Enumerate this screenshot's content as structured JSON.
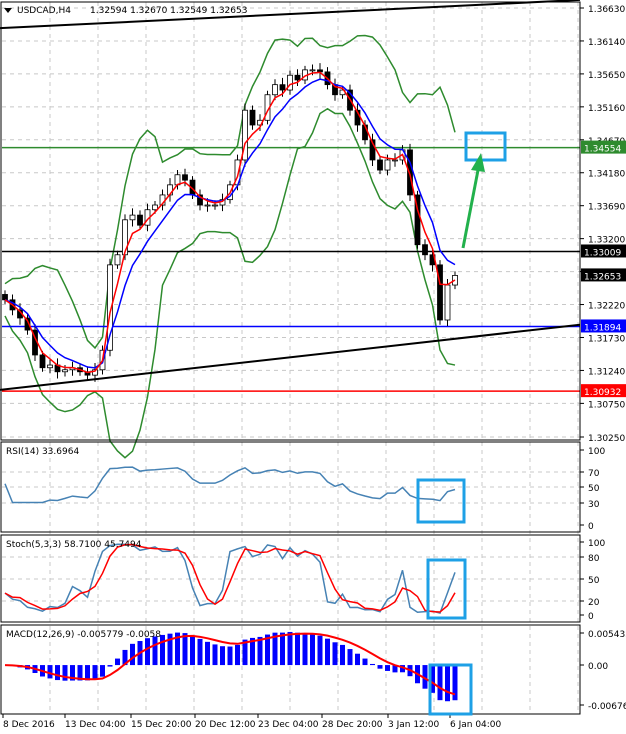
{
  "chart_data": {
    "type": "candlestick",
    "symbol_header": "USDCAD,H4",
    "ohlc_header": "1.32594 1.32670 1.32549 1.32653",
    "timeframe": "H4",
    "closes": [
      1.3229,
      1.3214,
      1.3202,
      1.3184,
      1.3147,
      1.3128,
      1.3132,
      1.3122,
      1.3125,
      1.3128,
      1.3122,
      1.3117,
      1.3125,
      1.3154,
      1.3281,
      1.3296,
      1.3348,
      1.3355,
      1.334,
      1.3363,
      1.337,
      1.3385,
      1.34,
      1.3415,
      1.3407,
      1.3385,
      1.337,
      1.337,
      1.337,
      1.3378,
      1.34,
      1.3437,
      1.3511,
      1.3489,
      1.3496,
      1.3534,
      1.3549,
      1.3541,
      1.3563,
      1.3556,
      1.3571,
      1.3571,
      1.3568,
      1.3549,
      1.3534,
      1.3541,
      1.3511,
      1.3489,
      1.3467,
      1.3437,
      1.3422,
      1.3437,
      1.3437,
      1.3452,
      1.3385,
      1.3311,
      1.3296,
      1.3281,
      1.3199,
      1.3251,
      1.32653
    ],
    "ylim": [
      1.3025,
      1.3663
    ],
    "price_ticks": [
      "1.36630",
      "1.36140",
      "1.35650",
      "1.35160",
      "1.34670",
      "1.34180",
      "1.33690",
      "1.33200",
      "1.32710",
      "1.32220",
      "1.31730",
      "1.31240",
      "1.30750",
      "1.30250"
    ],
    "levels": [
      {
        "price": 1.34554,
        "label": "1.34554",
        "color": "#2e8b2e"
      },
      {
        "price": 1.33009,
        "label": "1.33009",
        "color": "#000000"
      },
      {
        "price": 1.31894,
        "label": "1.31894",
        "color": "#0000ff"
      },
      {
        "price": 1.30932,
        "label": "1.30932",
        "color": "#ff0000"
      }
    ],
    "current_price": {
      "price": 1.32653,
      "label": "1.32653"
    },
    "trendlines": [
      {
        "from": [
          0,
          1.3633
        ],
        "to": [
          75,
          1.3675
        ],
        "color": "#000000"
      },
      {
        "from": [
          0,
          1.3095
        ],
        "to": [
          75,
          1.3192
        ],
        "color": "#000000"
      }
    ],
    "x_labels": [
      "8 Dec 2016",
      "13 Dec 04:00",
      "15 Dec 20:00",
      "20 Dec 12:00",
      "23 Dec 04:00",
      "28 Dec 20:00",
      "3 Jan 12:00",
      "6 Jan 04:00"
    ],
    "indicators": {
      "rsi": {
        "label": "RSI(14) 33.6964",
        "ticks": [
          "100",
          "70",
          "50",
          "30",
          "0"
        ],
        "range": [
          0,
          100
        ]
      },
      "stoch": {
        "label": "Stoch(5,3,3) 58.7100 45.7494",
        "ticks": [
          "100",
          "80",
          "50",
          "20",
          "0"
        ],
        "range": [
          0,
          100
        ]
      },
      "macd": {
        "label": "MACD(12,26,9) -0.005779 -0.0058",
        "ticks": [
          "0.005435",
          "0.00",
          "-0.006766"
        ],
        "range": [
          -0.006766,
          0.005435
        ]
      }
    },
    "colors": {
      "bull": "#000000",
      "bear": "#000000",
      "fast_ma": "#ff0000",
      "slow_ma": "#0000ff",
      "bands": "#2e8b2e",
      "line": "#4682b4",
      "annotation": "#1ea0e6"
    }
  }
}
